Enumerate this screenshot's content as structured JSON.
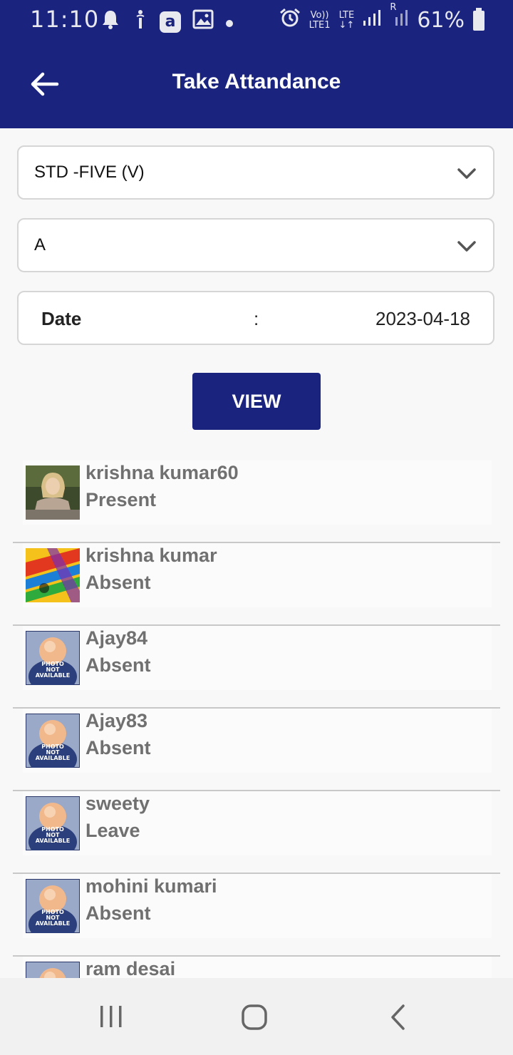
{
  "status_bar": {
    "time": "11:10",
    "volte_top": "Vo))",
    "volte_bottom": "LTE1",
    "lte_top": "LTE",
    "lte_bottom": "↓↑",
    "roaming": "R",
    "battery": "61%"
  },
  "header": {
    "title": "Take Attandance",
    "background": "#1a237e"
  },
  "form": {
    "class_select": "STD -FIVE (V)",
    "section_select": "A",
    "date_label": "Date",
    "date_separator": ":",
    "date_value": "2023-04-18",
    "view_button": "VIEW"
  },
  "students": [
    {
      "name": "krishna kumar60",
      "status": "Present",
      "photo": "woman-photo"
    },
    {
      "name": "krishna kumar",
      "status": "Absent",
      "photo": "colorful-photo"
    },
    {
      "name": "Ajay84",
      "status": "Absent",
      "photo": "photo-not-available"
    },
    {
      "name": "Ajay83",
      "status": "Absent",
      "photo": "photo-not-available"
    },
    {
      "name": "sweety",
      "status": "Leave",
      "photo": "photo-not-available"
    },
    {
      "name": "mohini kumari",
      "status": "Absent",
      "photo": "photo-not-available"
    },
    {
      "name": "ram desai",
      "status": "",
      "photo": "photo-not-available"
    }
  ],
  "placeholder_photo_text": [
    "PHOTO",
    "NOT",
    "AVAILABLE"
  ]
}
